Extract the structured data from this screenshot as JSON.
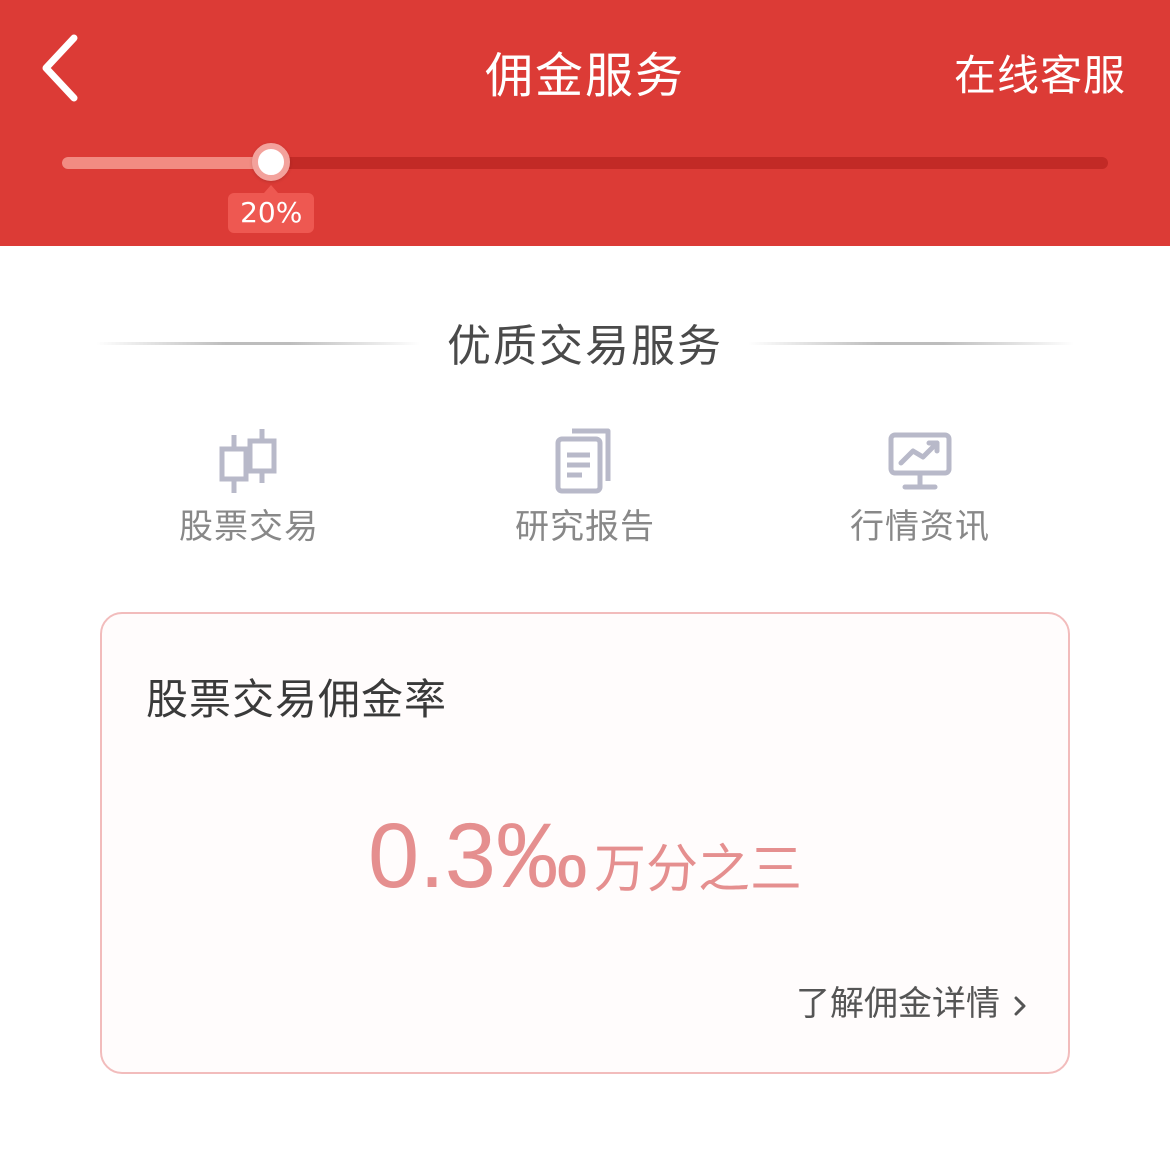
{
  "header": {
    "title": "佣金服务",
    "service_link": "在线客服",
    "slider": {
      "value_percent": 20,
      "label": "20%"
    }
  },
  "section": {
    "heading": "优质交易服务",
    "features": [
      {
        "label": "股票交易",
        "icon": "candlestick-icon"
      },
      {
        "label": "研究报告",
        "icon": "document-icon"
      },
      {
        "label": "行情资讯",
        "icon": "monitor-chart-icon"
      }
    ]
  },
  "card": {
    "title": "股票交易佣金率",
    "rate_value": "0.3‰",
    "rate_text": "万分之三",
    "detail_link": "了解佣金详情"
  },
  "colors": {
    "header_bg": "#dc3b36",
    "accent_pink": "#e58f8f",
    "card_border": "#f2bcbc"
  }
}
